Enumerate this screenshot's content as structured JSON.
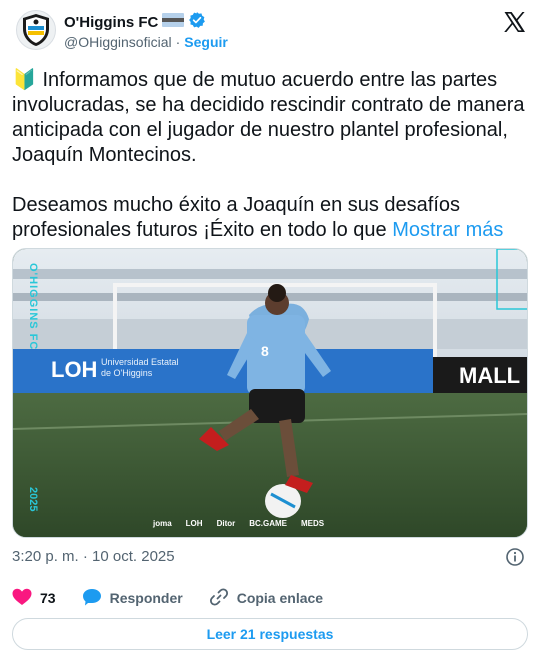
{
  "author": {
    "name": "O'Higgins FC",
    "handle": "@OHigginsoficial",
    "separator": "·",
    "follow_label": "Seguir"
  },
  "tweet": {
    "emoji": "🔰",
    "paragraph1": "Informamos que de mutuo acuerdo entre las partes involucradas, se ha decidido rescindir contrato de manera anticipada con el jugador de nuestro plantel profesional, Joaquín Montecinos.",
    "paragraph2": "Deseamos mucho éxito a Joaquín en sus desafíos profesionales futuros ¡Éxito en todo lo que",
    "show_more": "Mostrar más"
  },
  "media": {
    "side_text_top": "O'HIGGINS FC",
    "side_text_bottom": "2025",
    "jersey_number": "8",
    "ad_board_left": "LOH",
    "ad_board_text1": "Universidad Estatal",
    "ad_board_text2": "de O'Higgins",
    "ad_board_right": "MALL",
    "sponsors": [
      "joma",
      "LOH",
      "Ditor",
      "BC.GAME",
      "MEDS"
    ]
  },
  "meta": {
    "timestamp": "3:20 p. m. · 10 oct. 2025"
  },
  "actions": {
    "likes": "73",
    "reply_label": "Responder",
    "copy_label": "Copia enlace"
  },
  "replies_button": "Leer 21 respuestas",
  "colors": {
    "accent": "#1d9bf0",
    "like": "#f91880",
    "muted": "#536471",
    "verified": "#1d9bf0"
  }
}
